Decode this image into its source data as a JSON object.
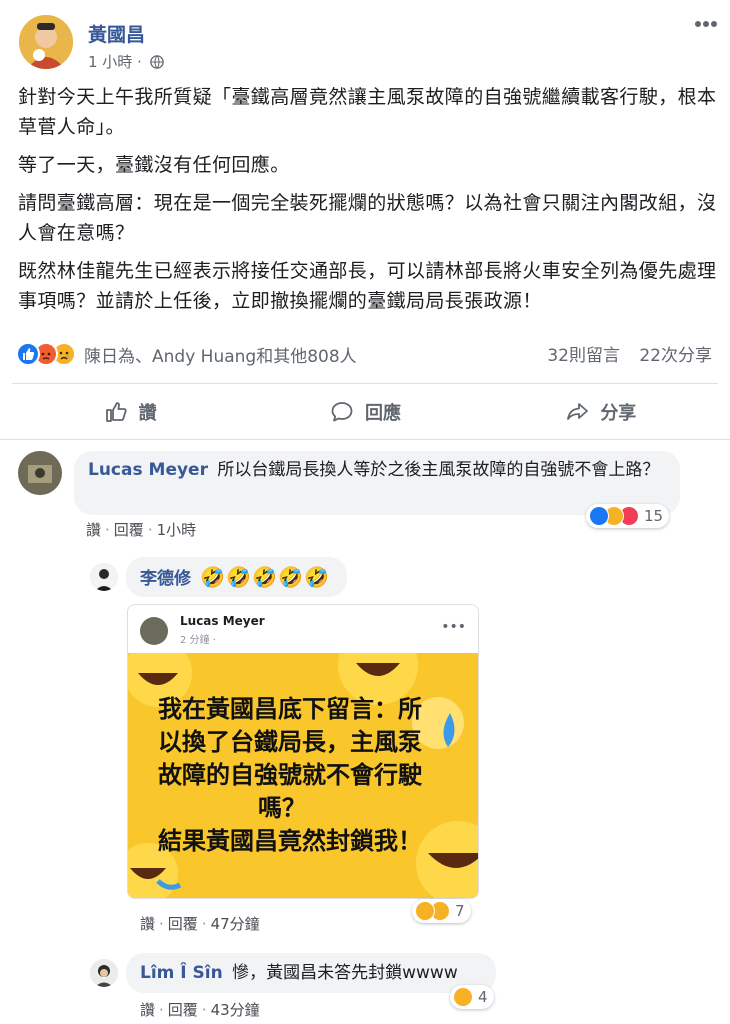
{
  "post": {
    "author": "黃國昌",
    "time": "1 小時 ·",
    "paragraphs": [
      "針對今天上午我所質疑「臺鐵高層竟然讓主風泵故障的自強號繼續載客行駛，根本草菅人命」。",
      "等了一天，臺鐵沒有任何回應。",
      "請問臺鐵高層：現在是一個完全裝死擺爛的狀態嗎？以為社會只關注內閣改組，沒人會在意嗎？",
      "既然林佳龍先生已經表示將接任交通部長，可以請林部長將火車安全列為優先處理事項嗎？並請於上任後，立即撤換擺爛的臺鐵局局長張政源！"
    ],
    "reaction_names": "陳日為、Andy Huang和其他808人",
    "comment_count": "32則留言",
    "share_count": "22次分享",
    "actions": {
      "like": "讚",
      "comment": "回應",
      "share": "分享"
    }
  },
  "comments": [
    {
      "author": "Lucas Meyer",
      "text": "所以台鐵局長換人等於之後主風泵故障的自強號不會上路？",
      "like": "讚",
      "reply": "回覆",
      "time": "1小時",
      "reaction_count": "15"
    },
    {
      "author": "李德修",
      "text": "🤣🤣🤣🤣🤣",
      "like": "讚",
      "reply": "回覆",
      "time": "47分鐘",
      "reaction_count": "7",
      "shared_post": {
        "author": "Lucas Meyer",
        "time": "2 分鐘 ·",
        "image_text": [
          "我在黃國昌底下留言：所",
          "以換了台鐵局長，主風泵",
          "故障的自強號就不會行駛",
          "嗎？",
          "結果黃國昌竟然封鎖我！"
        ]
      }
    },
    {
      "author": "Lîm Î Sîn",
      "text": "慘，黃國昌未答先封鎖wwww",
      "like": "讚",
      "reply": "回覆",
      "time": "43分鐘",
      "reaction_count": "4"
    }
  ],
  "colors": {
    "name_link": "#365899",
    "like_blue": "#1877f2",
    "bubble_bg": "#f2f3f5",
    "meme_yellow": "#f9c62c"
  }
}
